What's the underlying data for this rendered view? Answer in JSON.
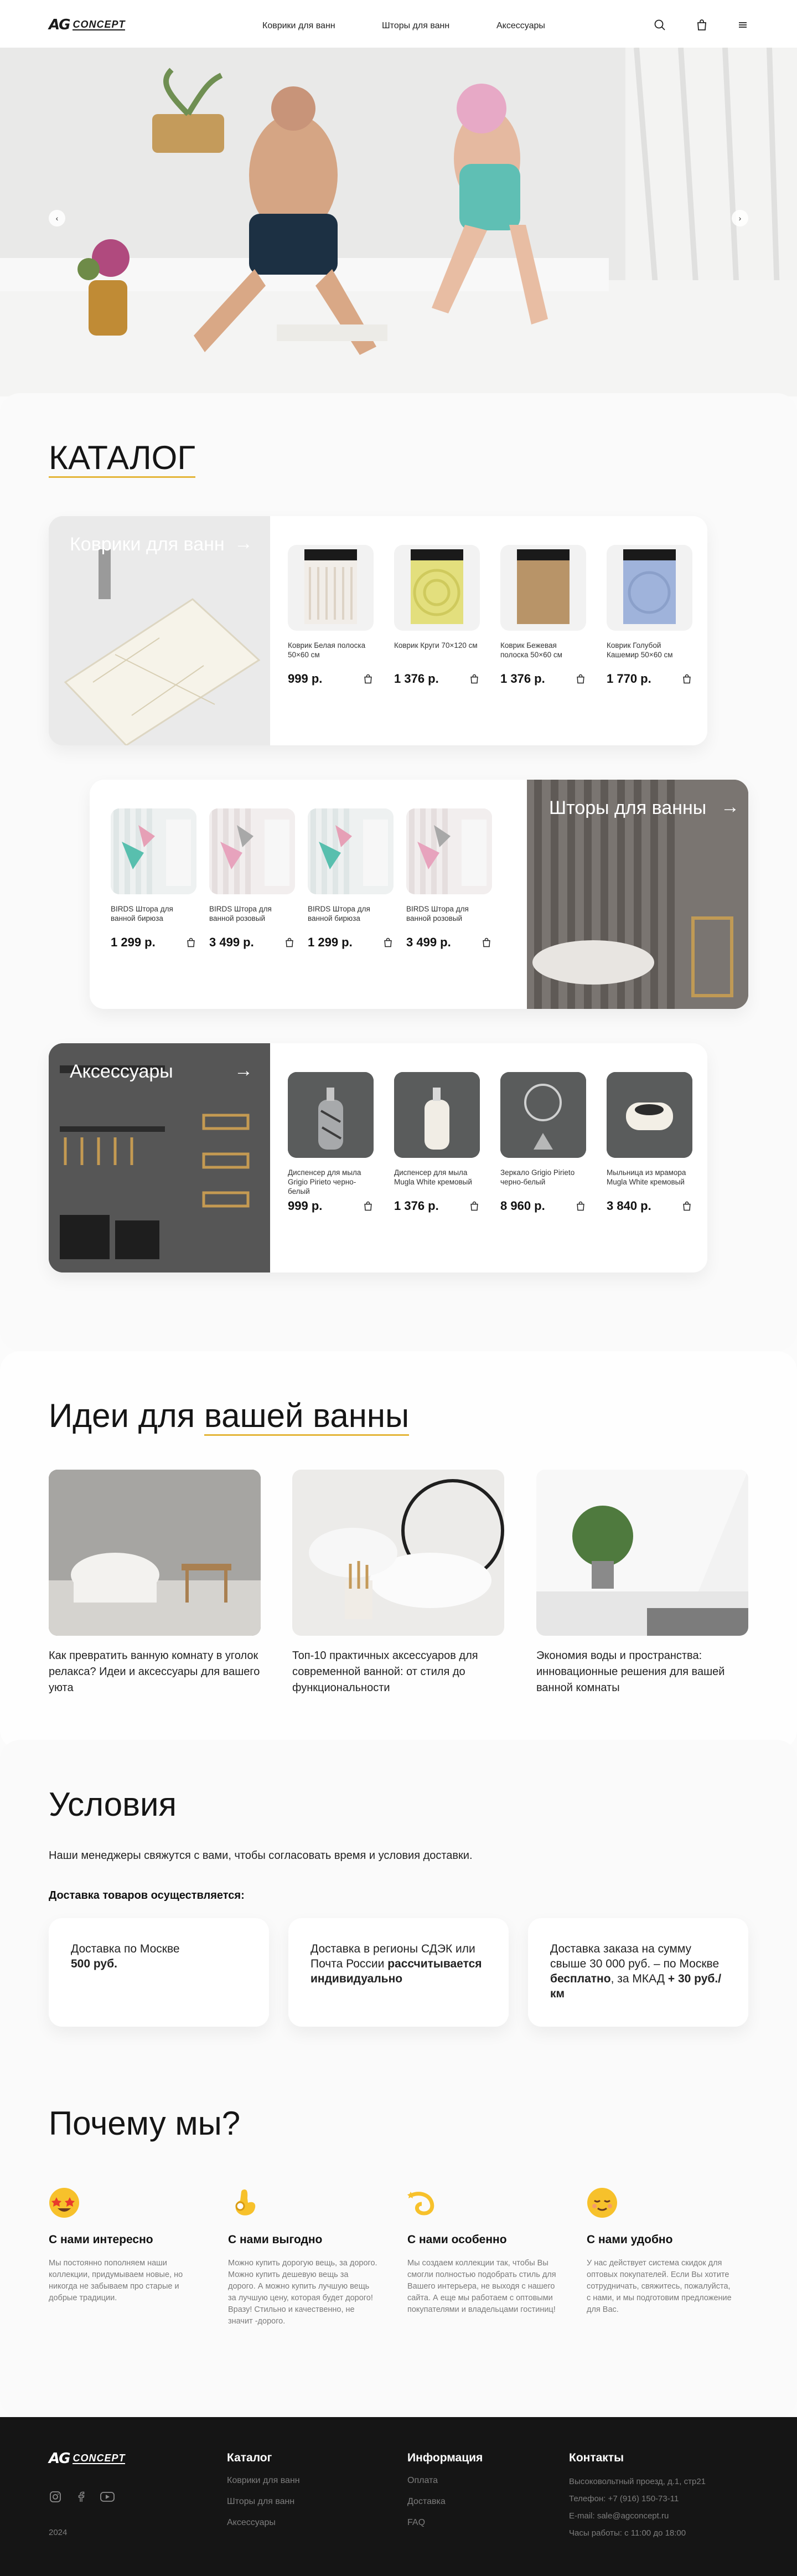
{
  "header": {
    "logo_ag": "AG",
    "logo_text": "CONCEPT",
    "nav": [
      "Коврики для ванн",
      "Шторы для ванн",
      "Аксессуары"
    ]
  },
  "hero": {
    "prev": "‹",
    "next": "›"
  },
  "catalog": {
    "title": "КАТАЛОГ",
    "mats": {
      "label": "Коврики для ванн",
      "products": [
        {
          "name": "Коврик Белая полоска 50×60 см",
          "price": "999 р."
        },
        {
          "name": "Коврик Круги 70×120 см",
          "price": "1 376 р."
        },
        {
          "name": "Коврик Бежевая полоска 50×60 см",
          "price": "1 376 р."
        },
        {
          "name": "Коврик Голубой Кашемир 50×60 см",
          "price": "1 770 р."
        }
      ]
    },
    "curtains": {
      "label": "Шторы для ванны",
      "products": [
        {
          "name": "BIRDS Штора для ванной бирюза",
          "price": "1 299 р."
        },
        {
          "name": "BIRDS Штора для ванной розовый",
          "price": "3 499 р."
        },
        {
          "name": "BIRDS Штора для ванной бирюза",
          "price": "1 299 р."
        },
        {
          "name": "BIRDS Штора для ванной розовый",
          "price": "3 499 р."
        }
      ]
    },
    "accessories": {
      "label": "Аксессуары",
      "products": [
        {
          "name": "Диспенсер для мыла Grigio Pirieto черно-белый",
          "price": "999 р."
        },
        {
          "name": "Диспенсер для мыла Mugla White кремовый",
          "price": "1 376 р."
        },
        {
          "name": "Зеркало Grigio Pirieto черно-белый",
          "price": "8 960 р."
        },
        {
          "name": "Мыльница из мрамора Mugla White кремовый",
          "price": "3 840 р."
        }
      ]
    }
  },
  "ideas": {
    "title_a": "Идеи для ",
    "title_b": "вашей ванны",
    "items": [
      "Как превратить ванную комнату в уголок релакса? Идеи и аксессуары для вашего уюта",
      "Топ-10 практичных аксессуаров для современной ванной: от стиля до функциональности",
      "Экономия воды и пространства: инновационные решения для вашей ванной комнаты"
    ]
  },
  "conditions": {
    "title": "Условия",
    "intro": "Наши менеджеры свяжутся с вами, чтобы согласовать время и условия доставки.",
    "subtitle": "Доставка товаров осуществляется:",
    "c1a": "Доставка по Москве",
    "c1b": "500 руб.",
    "c2a": "Доставка в регионы СДЭК или Почта России ",
    "c2b": "рассчитывается индивидуально",
    "c3a": "Доставка заказа на сумму свыше 30 000 руб. – по Москве ",
    "c3b": "бесплатно",
    "c3c": ", за МКАД ",
    "c3d": "+ 30 руб./км"
  },
  "why": {
    "title": "Почему мы?",
    "items": [
      {
        "head": "С нами интересно",
        "text": "Мы постоянно пополняем наши коллекции, придумываем новые, но никогда не забываем про старые и добрые традиции."
      },
      {
        "head": "С нами выгодно",
        "text": "Можно купить дорогую вещь, за дорого. Можно купить дешевую вещь за дорого. А можно купить лучшую вещь за лучшую цену, которая будет дорого! Вразу! Стильно и качественно, не значит -дорого."
      },
      {
        "head": "С нами особенно",
        "text": "Мы создаем коллекции так, чтобы Вы смогли полностью подобрать стиль для Вашего интерьера, не выходя с нашего сайта. А еще мы работаем с оптовыми покупателями и владельцами гостиниц!"
      },
      {
        "head": "С нами удобно",
        "text": "У нас действует система скидок для оптовых покупателей. Если Вы хотите сотрудничать, свяжитесь, пожалуйста, с нами, и мы подготовим предложение для Вас."
      }
    ]
  },
  "footer": {
    "year": "2024",
    "catalog_head": "Каталог",
    "catalog_links": [
      "Коврики для ванн",
      "Шторы для ванн",
      "Аксессуары"
    ],
    "info_head": "Информация",
    "info_links": [
      "Оплата",
      "Доставка",
      "FAQ"
    ],
    "contacts_head": "Контакты",
    "contacts": [
      "Высоковольтный проезд, д.1, стр21",
      "Телефон: +7 (916) 150-73-11",
      "E-mail: sale@agconcept.ru",
      "Часы работы: с 11:00 до 18:00"
    ]
  },
  "colors": {
    "accent": "#e4b63a",
    "footer_bg": "#151515"
  }
}
